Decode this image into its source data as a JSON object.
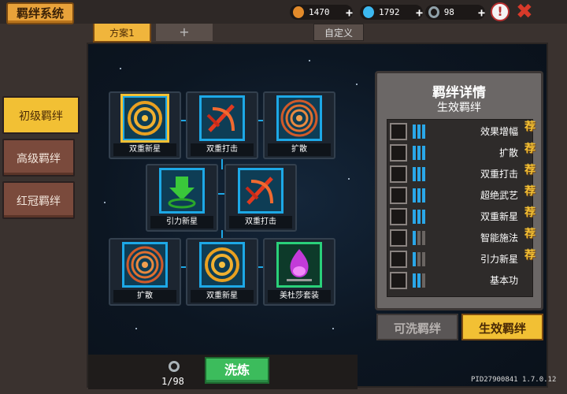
{
  "header": {
    "title": "羁绊系统",
    "resources": [
      {
        "icon": "carrot-icon",
        "value": "1470",
        "color": "#e28a2a"
      },
      {
        "icon": "gem-icon",
        "value": "1792",
        "color": "#3cb8f0"
      },
      {
        "icon": "ring-icon",
        "value": "98",
        "color": "#8fa0a8"
      }
    ],
    "plus": "+",
    "help": "!"
  },
  "tabs": {
    "scheme": "方案1",
    "add": "+",
    "custom": "自定义"
  },
  "side_tabs": [
    "初级羁绊",
    "高级羁绊",
    "红冠羁绊"
  ],
  "grid": [
    {
      "label": "双重新星",
      "icon": "double-nova-icon"
    },
    {
      "label": "双重打击",
      "icon": "double-strike-icon"
    },
    {
      "label": "扩散",
      "icon": "spread-icon"
    },
    {
      "label": "引力新星",
      "icon": "gravity-nova-icon"
    },
    {
      "label": "双重打击",
      "icon": "double-strike-icon"
    },
    {
      "label": "扩散",
      "icon": "spread-icon"
    },
    {
      "label": "双重新星",
      "icon": "double-nova-icon"
    },
    {
      "label": "美杜莎套装",
      "icon": "medusa-set-icon"
    }
  ],
  "details": {
    "title": "羁绊详情",
    "subtitle": "生效羁绊",
    "rows": [
      {
        "name": "效果增幅",
        "on": 3,
        "rec": "荐"
      },
      {
        "name": "扩散",
        "on": 3,
        "rec": "荐"
      },
      {
        "name": "双重打击",
        "on": 3,
        "rec": "荐"
      },
      {
        "name": "超绝武艺",
        "on": 3,
        "rec": "荐"
      },
      {
        "name": "双重新星",
        "on": 3,
        "rec": "荐"
      },
      {
        "name": "智能施法",
        "on": 1,
        "rec": "荐"
      },
      {
        "name": "引力新星",
        "on": 1,
        "rec": "荐"
      },
      {
        "name": "基本功",
        "on": 2,
        "rec": ""
      }
    ],
    "tab_washable": "可洗羁绊",
    "tab_active": "生效羁绊"
  },
  "bottom": {
    "counter": "1/98",
    "wash": "洗炼"
  },
  "version": "PID27900841 1.7.0.12"
}
